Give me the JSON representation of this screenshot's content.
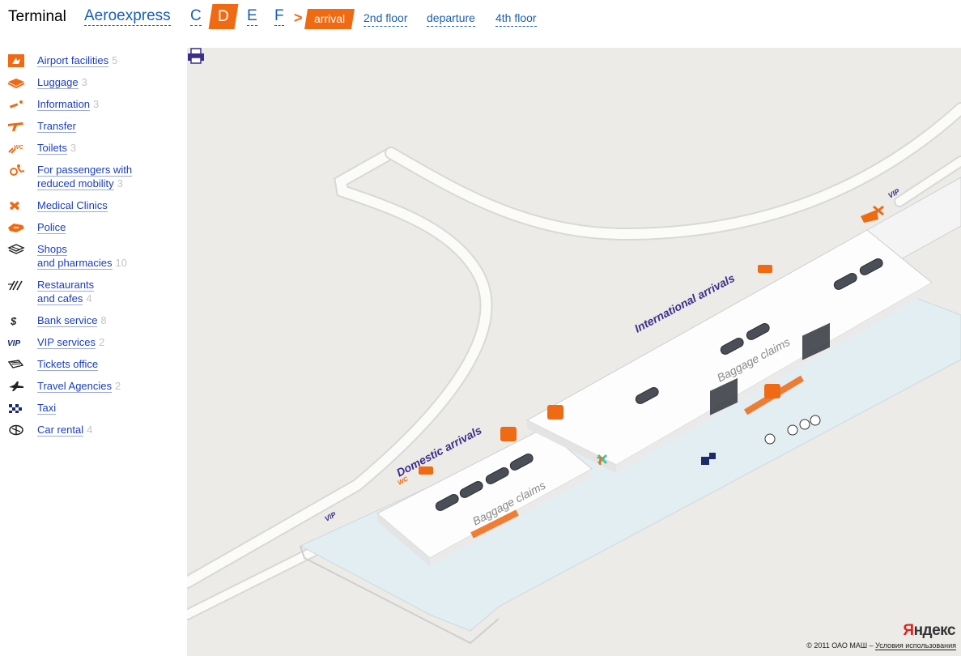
{
  "nav": {
    "title": "Terminal",
    "aeroexpress": "Aeroexpress",
    "terminals": [
      "C",
      "D",
      "E",
      "F"
    ],
    "active_terminal": "D",
    "arrow": ">",
    "active_level": "arrival",
    "levels": [
      "2nd floor",
      "departure",
      "4th floor"
    ]
  },
  "legend": {
    "items": [
      {
        "label": "Airport facilities",
        "count": "5",
        "icon": "airport-facilities-icon"
      },
      {
        "label": "Luggage",
        "count": "3",
        "icon": "luggage-icon"
      },
      {
        "label": "Information",
        "count": "3",
        "icon": "information-icon"
      },
      {
        "label": "Transfer",
        "count": "",
        "icon": "transfer-icon"
      },
      {
        "label": "Toilets",
        "count": "3",
        "icon": "toilets-icon"
      },
      {
        "label_1": "For passengers with",
        "label_2": "reduced mobility",
        "count": "3",
        "icon": "reduced-mobility-icon"
      },
      {
        "label": "Medical Clinics",
        "count": "",
        "icon": "medical-icon"
      },
      {
        "label": "Police",
        "count": "",
        "icon": "police-icon"
      },
      {
        "label_1": "Shops",
        "label_2": "and pharmacies",
        "count": "10",
        "icon": "shops-icon"
      },
      {
        "label_1": "Restaurants",
        "label_2": "and cafes",
        "count": "4",
        "icon": "restaurants-icon"
      },
      {
        "label": "Bank service",
        "count": "8",
        "icon": "bank-icon"
      },
      {
        "label": "VIP services",
        "count": "2",
        "icon": "vip-icon"
      },
      {
        "label": "Tickets office",
        "count": "",
        "icon": "tickets-icon"
      },
      {
        "label": "Travel Agencies",
        "count": "2",
        "icon": "travel-agencies-icon"
      },
      {
        "label": "Taxi",
        "count": "",
        "icon": "taxi-icon"
      },
      {
        "label": "Car rental",
        "count": "4",
        "icon": "car-rental-icon"
      }
    ]
  },
  "map": {
    "labels": {
      "international_arrivals": "International arrivals",
      "domestic_arrivals": "Domestic arrivals",
      "baggage_claims_1": "Baggage claims",
      "baggage_claims_2": "Baggage claims",
      "vip_1": "VIP",
      "vip_2": "VIP",
      "wc": "WC"
    },
    "yandex_1": "Я",
    "yandex_2": "ндекс",
    "copyright": "© 2011 ОАО МАШ – ",
    "terms": "Условия использования",
    "accent_color": "#f06a14",
    "label_color": "#3b2f8a",
    "map_background": "#ecebe8"
  }
}
